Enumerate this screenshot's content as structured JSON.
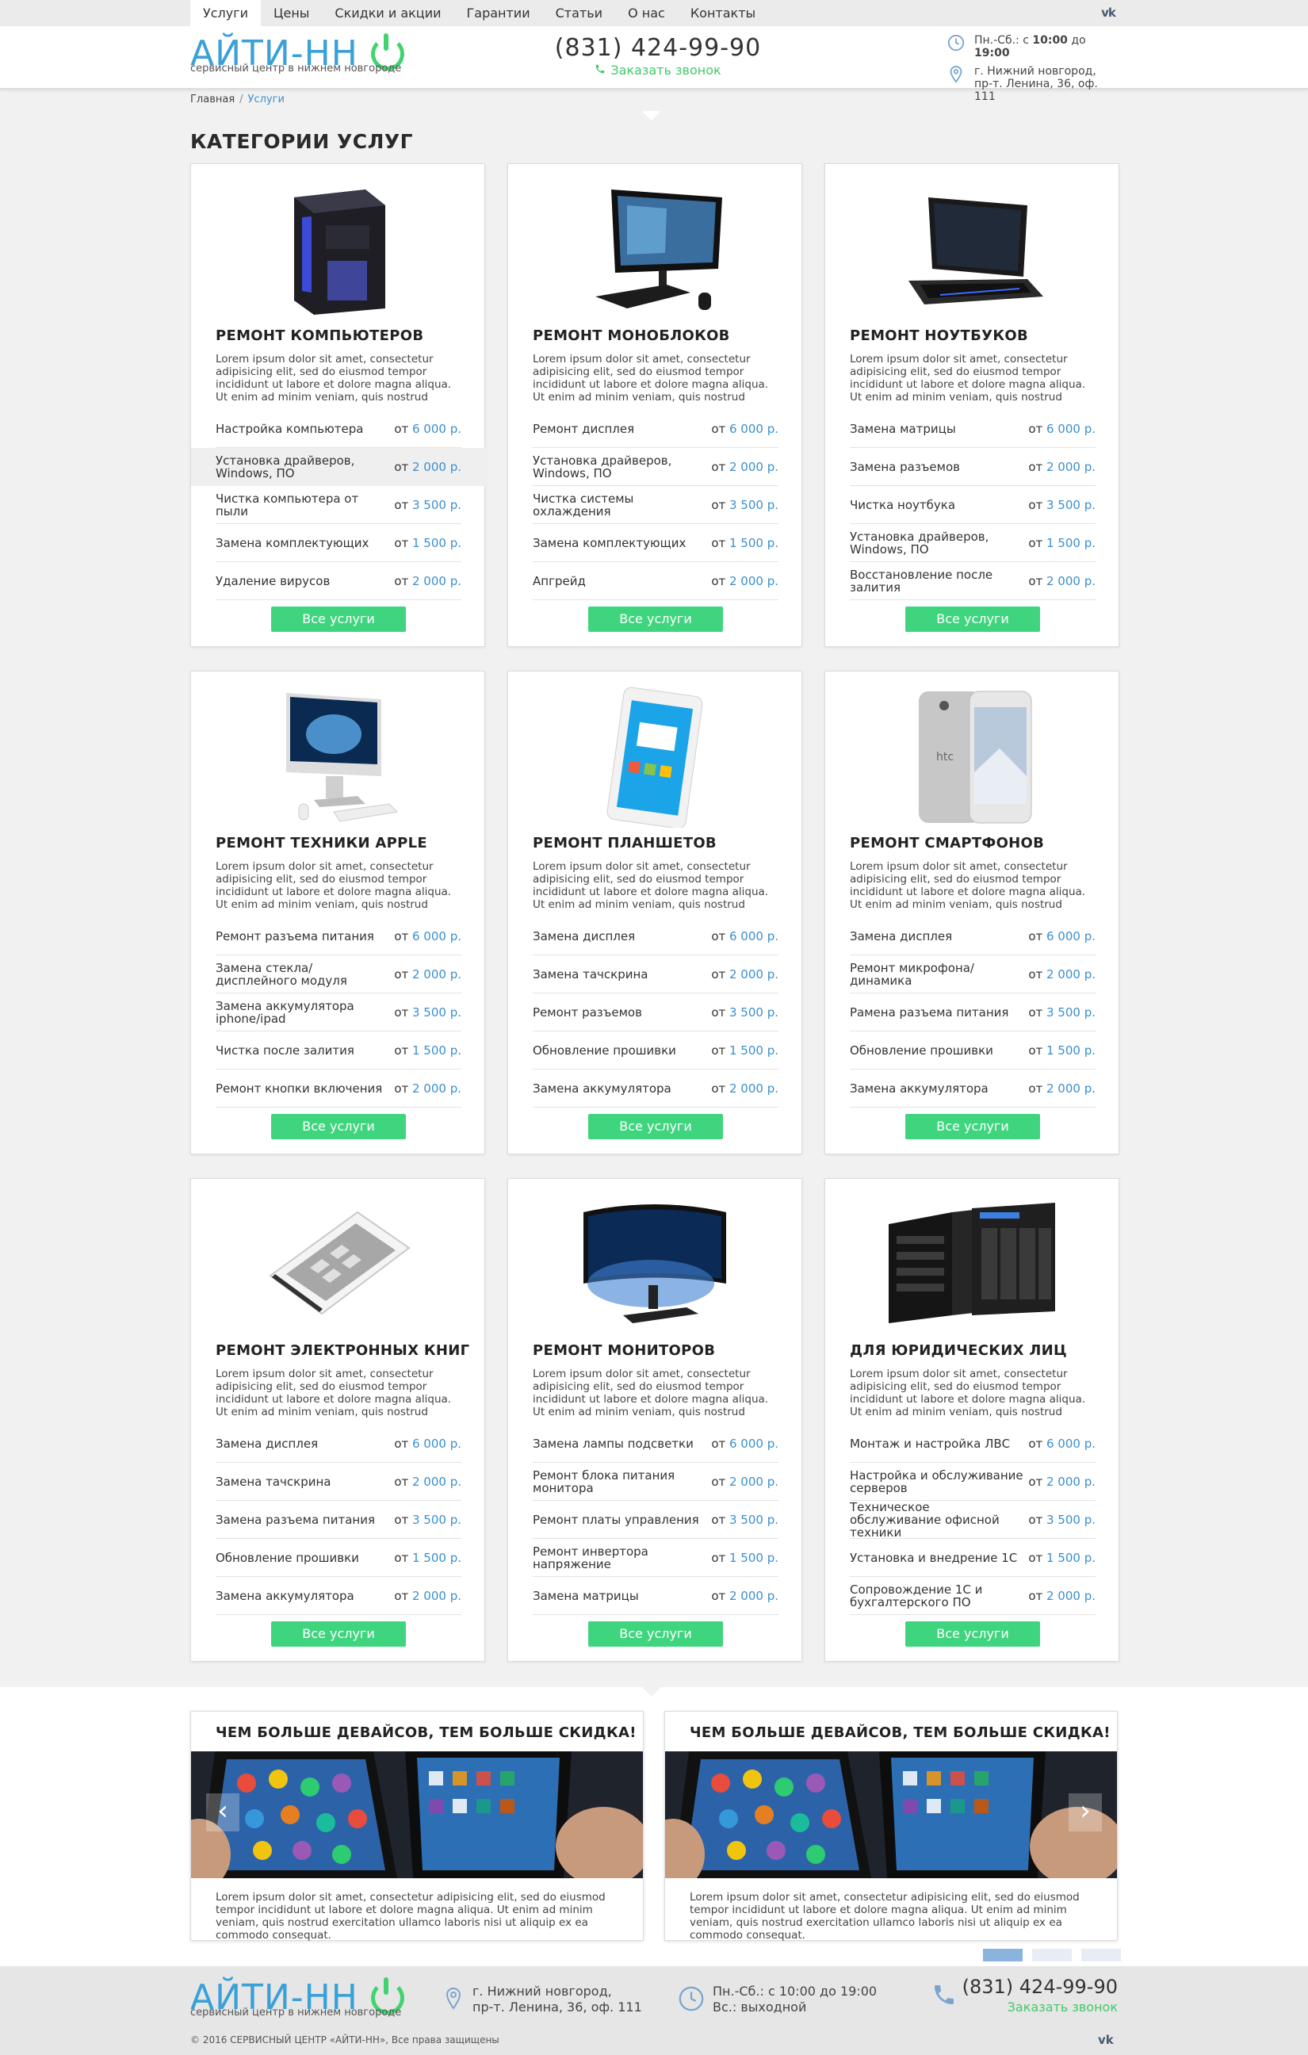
{
  "nav": {
    "items": [
      "Услуги",
      "Цены",
      "Скидки и акции",
      "Гарантии",
      "Статьи",
      "О нас",
      "Контакты"
    ],
    "social": "vk"
  },
  "header": {
    "logo": "АЙТИ-НН",
    "tagline": "сервисный центр в нижнем новгороде",
    "phone": "(831) 424-99-90",
    "callback": "Заказать звонок",
    "hours_prefix": "Пн.-Сб.: с ",
    "hours_from": "10:00",
    "hours_mid": " до ",
    "hours_to": "19:00",
    "address_line1": "г. Нижний новгород,",
    "address_line2": "пр-т. Ленина, 36, оф. 111"
  },
  "breadcrumb": {
    "home": "Главная",
    "sep": "/",
    "current": "Услуги"
  },
  "section_title": "КАТЕГОРИИ УСЛУГ",
  "lorem": "Lorem ipsum dolor sit amet, consectetur adipisicing elit, sed do eiusmod tempor incididunt ut labore et dolore magna aliqua. Ut enim ad minim veniam, quis nostrud exercitation",
  "lorem_ext": "Lorem ipsum dolor sit amet, consectetur adipisicing elit, sed do eiusmod tempor incididunt ut labore et dolore magna aliqua. Ut enim ad minim veniam, quis nostrud exercitation ullamco laboris nisi ut",
  "button_label": "Все услуги",
  "price_prefix": "от ",
  "cards": [
    {
      "title": "РЕМОНТ КОМПЬЮТЕРОВ",
      "icon": "desktop-pc",
      "ext": false,
      "services": [
        [
          "Настройка компьютера",
          "6 000 р."
        ],
        [
          "Установка драйверов, Windows, ПО",
          "2 000 р."
        ],
        [
          "Чистка компьютера от пыли",
          "3 500 р."
        ],
        [
          "Замена комплектующих",
          "1 500 р."
        ],
        [
          "Удаление вирусов",
          "2 000 р."
        ]
      ]
    },
    {
      "title": "РЕМОНТ МОНОБЛОКОВ",
      "icon": "all-in-one",
      "ext": false,
      "services": [
        [
          "Ремонт дисплея",
          "6 000 р."
        ],
        [
          "Установка драйверов, Windows, ПО",
          "2 000 р."
        ],
        [
          "Чистка системы охлаждения",
          "3 500 р."
        ],
        [
          "Замена комплектующих",
          "1 500 р."
        ],
        [
          "Апгрейд",
          "2 000 р."
        ]
      ]
    },
    {
      "title": "РЕМОНТ НОУТБУКОВ",
      "icon": "laptop",
      "ext": false,
      "services": [
        [
          "Замена матрицы",
          "6 000 р."
        ],
        [
          "Замена разъемов",
          "2 000 р."
        ],
        [
          "Чистка ноутбука",
          "3 500 р."
        ],
        [
          "Установка драйверов, Windows, ПО",
          "1 500 р."
        ],
        [
          "Восстановление после залития",
          "2 000 р."
        ]
      ]
    },
    {
      "title": "РЕМОНТ ТЕХНИКИ APPLE",
      "icon": "imac",
      "ext": true,
      "services": [
        [
          "Ремонт разъема питания",
          "6 000 р."
        ],
        [
          "Замена стекла/ дисплейного модуля",
          "2 000 р."
        ],
        [
          "Замена аккумулятора iphone/ipad",
          "3 500 р."
        ],
        [
          "Чистка после залития",
          "1 500 р."
        ],
        [
          "Ремонт кнопки включения",
          "2 000 р."
        ]
      ]
    },
    {
      "title": "РЕМОНТ ПЛАНШЕТОВ",
      "icon": "tablet",
      "ext": false,
      "services": [
        [
          "Замена дисплея",
          "6 000 р."
        ],
        [
          "Замена тачскрина",
          "2 000 р."
        ],
        [
          "Ремонт разъемов",
          "3 500 р."
        ],
        [
          "Обновление прошивки",
          "1 500 р."
        ],
        [
          "Замена аккумулятора",
          "2 000 р."
        ]
      ]
    },
    {
      "title": "РЕМОНТ СМАРТФОНОВ",
      "icon": "smartphone",
      "ext": false,
      "services": [
        [
          "Замена дисплея",
          "6 000 р."
        ],
        [
          "Ремонт микрофона/ динамика",
          "2 000 р."
        ],
        [
          "Рамена разъема питания",
          "3 500 р."
        ],
        [
          "Обновление прошивки",
          "1 500 р."
        ],
        [
          "Замена аккумулятора",
          "2 000 р."
        ]
      ]
    },
    {
      "title": "РЕМОНТ ЭЛЕКТРОННЫХ КНИГ",
      "icon": "ebook",
      "ext": false,
      "services": [
        [
          "Замена дисплея",
          "6 000 р."
        ],
        [
          "Замена тачскрина",
          "2 000 р."
        ],
        [
          "Замена разъема питания",
          "3 500 р."
        ],
        [
          "Обновление прошивки",
          "1 500 р."
        ],
        [
          "Замена аккумулятора",
          "2 000 р."
        ]
      ]
    },
    {
      "title": "РЕМОНТ МОНИТОРОВ",
      "icon": "monitor",
      "ext": false,
      "services": [
        [
          "Замена лампы подсветки",
          "6 000 р."
        ],
        [
          "Ремонт блока питания монитора",
          "2 000 р."
        ],
        [
          "Ремонт платы управления",
          "3 500 р."
        ],
        [
          "Ремонт инвертора напряжение",
          "1 500 р."
        ],
        [
          "Замена матрицы",
          "2 000 р."
        ]
      ]
    },
    {
      "title": "ДЛЯ ЮРИДИЧЕСКИХ ЛИЦ",
      "icon": "server",
      "ext": false,
      "services": [
        [
          "Монтаж и настройка ЛВС",
          "6 000 р."
        ],
        [
          "Настройка и обслуживание серверов",
          "2 000 р."
        ],
        [
          "Техническое обслуживание офисной техники",
          "3 500 р."
        ],
        [
          "Установка и внедрение 1С",
          "1 500 р."
        ],
        [
          "Сопровождение 1С и бухгалтерского ПО",
          "2 000 р."
        ]
      ]
    }
  ],
  "promos": [
    {
      "title": "ЧЕМ БОЛЬШЕ ДЕВАЙСОВ, ТЕМ БОЛЬШЕ СКИДКА!",
      "text": "Lorem ipsum dolor sit amet, consectetur adipisicing elit, sed do eiusmod tempor incididunt ut labore et dolore magna aliqua. Ut enim ad minim veniam, quis nostrud exercitation ullamco laboris nisi ut aliquip ex ea commodo consequat."
    },
    {
      "title": "ЧЕМ БОЛЬШЕ ДЕВАЙСОВ, ТЕМ БОЛЬШЕ СКИДКА!",
      "text": "Lorem ipsum dolor sit amet, consectetur adipisicing elit, sed do eiusmod tempor incididunt ut labore et dolore magna aliqua. Ut enim ad minim veniam, quis nostrud exercitation ullamco laboris nisi ut aliquip ex ea commodo consequat."
    }
  ],
  "slider": {
    "prev": "‹",
    "next": "›",
    "active_dot": 0
  },
  "footer": {
    "logo": "АЙТИ-НН",
    "tagline": "сервисный центр в нижнем новгороде",
    "address_line1": "г. Нижний новгород,",
    "address_line2": "пр-т. Ленина, 36, оф. 111",
    "hours_line1": "Пн.-Сб.: с 10:00 до 19:00",
    "hours_line2": "Вс.: выходной",
    "phone": "(831) 424-99-90",
    "callback": "Заказать звонок",
    "copyright": "© 2016 СЕРВИСНЫЙ ЦЕНТР «АЙТИ-НН», Все права защищены"
  },
  "colors": {
    "accent_blue": "#3a8fcf",
    "accent_green": "#3fd57f",
    "logo_blue": "#3aa0d8"
  }
}
